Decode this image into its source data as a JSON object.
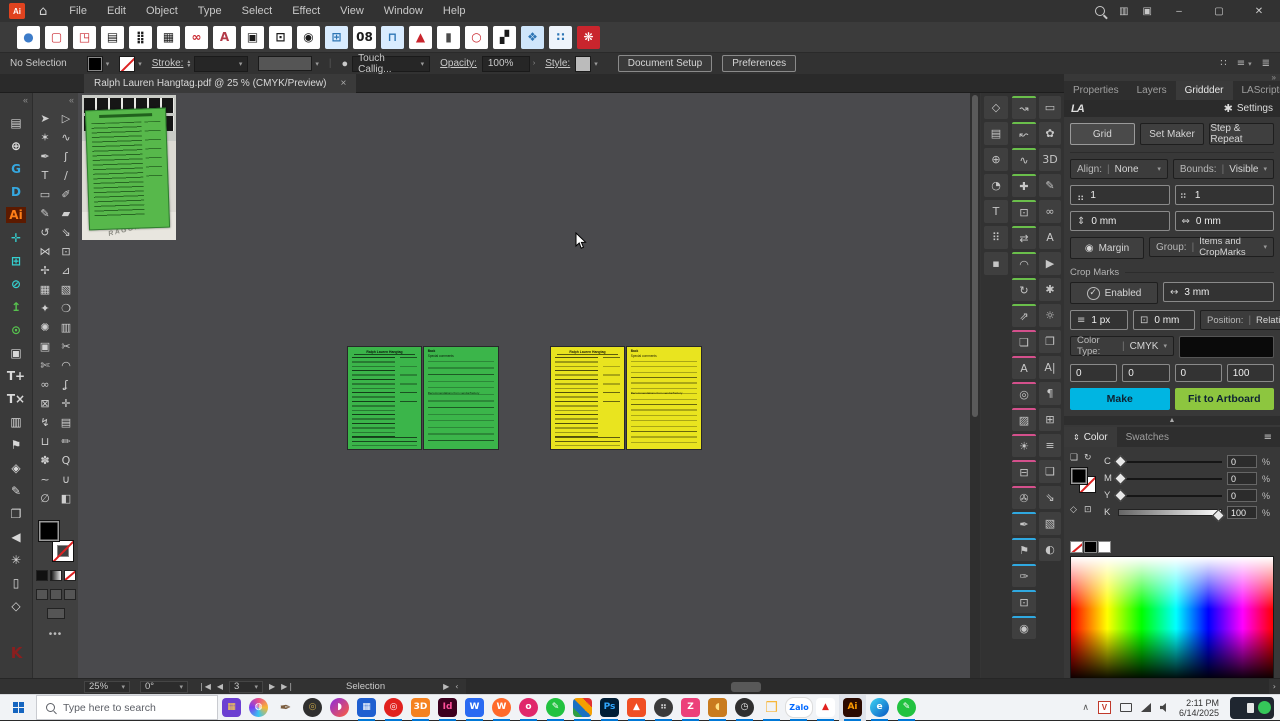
{
  "theme": {
    "bg-dark": "#323232",
    "bg-panel": "#383838",
    "canvas": "#4a4a4d",
    "green": "#3bb54a",
    "yellow": "#e9e41f",
    "make": "#00b5e2",
    "fit": "#8dc63f",
    "accent-run": "#0078d7",
    "taskbar": "#f1f3f6"
  },
  "titlebar": {
    "app_badge": "Ai",
    "menus": [
      "File",
      "Edit",
      "Object",
      "Type",
      "Select",
      "Effect",
      "View",
      "Window",
      "Help"
    ],
    "minimize_glyph": "–",
    "maximize_glyph": "▢",
    "close_glyph": "✕"
  },
  "plugin_toolbar": {
    "icons": [
      {
        "name": "apple-icon",
        "glyph": "●",
        "fg": "#3d7cc9",
        "bg": "#ffffff"
      },
      {
        "name": "red-frame-icon",
        "glyph": "▢",
        "fg": "#c9252d",
        "bg": "#ffffff"
      },
      {
        "name": "red-frame-plus-icon",
        "glyph": "◳",
        "fg": "#c9252d",
        "bg": "#ffffff"
      },
      {
        "name": "storefront-icon",
        "glyph": "▤",
        "fg": "#1b1b1b",
        "bg": "#ffffff"
      },
      {
        "name": "dot-grid-icon",
        "glyph": "⣿",
        "fg": "#1b1b1b",
        "bg": "#ffffff"
      },
      {
        "name": "table-icon",
        "glyph": "▦",
        "fg": "#1b1b1b",
        "bg": "#ffffff"
      },
      {
        "name": "swap-rings-icon",
        "glyph": "∞",
        "fg": "#c9252d",
        "bg": "#ffffff"
      },
      {
        "name": "initial-a-icon",
        "glyph": "A",
        "fg": "#b23a48",
        "bg": "#ffffff"
      },
      {
        "name": "frame-icon",
        "glyph": "▣",
        "fg": "#1b1b1b",
        "bg": "#ffffff"
      },
      {
        "name": "crop-marks-icon",
        "glyph": "⊡",
        "fg": "#1b1b1b",
        "bg": "#ffffff"
      },
      {
        "name": "eye-icon",
        "glyph": "◉",
        "fg": "#1b1b1b",
        "bg": "#ffffff"
      },
      {
        "name": "add-frame-icon",
        "glyph": "⊞",
        "fg": "#2e76b5",
        "bg": "#d9ecff"
      },
      {
        "name": "pages-icon",
        "glyph": "08",
        "fg": "#1b1b1b",
        "bg": "#ffffff"
      },
      {
        "name": "printer-icon",
        "glyph": "⊓",
        "fg": "#2e76b5",
        "bg": "#d9ecff"
      },
      {
        "name": "pdf-icon",
        "glyph": "▲",
        "fg": "#c9252d",
        "bg": "#ffffff"
      },
      {
        "name": "pen-knife-icon",
        "glyph": "▮",
        "fg": "#4a4a4a",
        "bg": "#ffffff"
      },
      {
        "name": "apple-outline-icon",
        "glyph": "○",
        "fg": "#c9252d",
        "bg": "#ffffff"
      },
      {
        "name": "qr-icon",
        "glyph": "▞",
        "fg": "#1b1b1b",
        "bg": "#ffffff"
      },
      {
        "name": "touch-icon",
        "glyph": "❖",
        "fg": "#2e76b5",
        "bg": "#cfe6fb"
      },
      {
        "name": "marquee-dots-icon",
        "glyph": "∷",
        "fg": "#2e76b5",
        "bg": "#eef4fb"
      },
      {
        "name": "flower-icon",
        "glyph": "❋",
        "fg": "#ffffff",
        "bg": "#c9252d"
      }
    ]
  },
  "control_bar": {
    "selection_status": "No Selection",
    "stroke_label": "Stroke:",
    "brush_value": "Touch Callig...",
    "opacity_label": "Opacity:",
    "opacity_value": "100%",
    "style_label": "Style:",
    "document_setup_label": "Document Setup",
    "preferences_label": "Preferences"
  },
  "document_tab": {
    "title": "Ralph Lauren Hangtag.pdf @ 25 % (CMYK/Preview)",
    "close_glyph": "×"
  },
  "left_dock": {
    "icons": [
      {
        "name": "folder-icon",
        "glyph": "▤",
        "fg": "#cfcfcf"
      },
      {
        "name": "add-circle-icon",
        "glyph": "⊕",
        "fg": "#e0e0e0"
      },
      {
        "name": "g-tool-icon",
        "glyph": "G",
        "fg": "#35a8e0"
      },
      {
        "name": "d-tool-icon",
        "glyph": "D",
        "fg": "#35a8e0"
      },
      {
        "name": "ai-badge-icon",
        "glyph": "Ai",
        "fg": "#ff7f18",
        "bg": "#5c1a00"
      },
      {
        "name": "align-cross-icon",
        "glyph": "✛",
        "fg": "#35d0d0"
      },
      {
        "name": "grid-icon",
        "glyph": "⊞",
        "fg": "#35d0d0"
      },
      {
        "name": "slash-circle-icon",
        "glyph": "⊘",
        "fg": "#35d0d0"
      },
      {
        "name": "export-icon",
        "glyph": "↥",
        "fg": "#57c24e"
      },
      {
        "name": "power-icon",
        "glyph": "⊙",
        "fg": "#57c24e"
      },
      {
        "name": "swatch-grid-icon",
        "glyph": "▣",
        "fg": "#d8d8d8"
      },
      {
        "name": "type-plus-icon",
        "glyph": "T+",
        "fg": "#d8d8d8"
      },
      {
        "name": "type-x-icon",
        "glyph": "T×",
        "fg": "#d8d8d8"
      },
      {
        "name": "columns-icon",
        "glyph": "▥",
        "fg": "#d8d8d8"
      },
      {
        "name": "flag-icon",
        "glyph": "⚑",
        "fg": "#d8d8d8"
      },
      {
        "name": "diamond-icon",
        "glyph": "◈",
        "fg": "#d8d8d8"
      },
      {
        "name": "pen-box-icon",
        "glyph": "✎",
        "fg": "#d8d8d8"
      },
      {
        "name": "link-box-icon",
        "glyph": "❐",
        "fg": "#d8d8d8"
      },
      {
        "name": "triangle-icon",
        "glyph": "◀",
        "fg": "#d8d8d8"
      },
      {
        "name": "node-icon",
        "glyph": "✳",
        "fg": "#d8d8d8"
      },
      {
        "name": "book-icon",
        "glyph": "▯",
        "fg": "#d8d8d8"
      },
      {
        "name": "cube-icon",
        "glyph": "◇",
        "fg": "#d8d8d8"
      }
    ],
    "bottom_logo": {
      "name": "k-logo-icon",
      "glyph": "K",
      "fg": "#8b1f1f"
    }
  },
  "toolbar_tools": {
    "items": [
      {
        "name": "selection-tool",
        "glyph": "➤"
      },
      {
        "name": "direct-selection-tool",
        "glyph": "▷"
      },
      {
        "name": "magic-wand-tool",
        "glyph": "✶"
      },
      {
        "name": "lasso-tool",
        "glyph": "∿"
      },
      {
        "name": "pen-tool",
        "glyph": "✒"
      },
      {
        "name": "curvature-tool",
        "glyph": "ʃ"
      },
      {
        "name": "type-tool",
        "glyph": "T"
      },
      {
        "name": "line-tool",
        "glyph": "∕"
      },
      {
        "name": "rectangle-tool",
        "glyph": "▭"
      },
      {
        "name": "paintbrush-tool",
        "glyph": "✐"
      },
      {
        "name": "shaper-tool",
        "glyph": "✎"
      },
      {
        "name": "eraser-tool",
        "glyph": "▰"
      },
      {
        "name": "rotate-tool",
        "glyph": "↺"
      },
      {
        "name": "scale-tool",
        "glyph": "⇘"
      },
      {
        "name": "width-tool",
        "glyph": "⋈"
      },
      {
        "name": "free-transform-tool",
        "glyph": "⊡"
      },
      {
        "name": "puppet-warp-tool",
        "glyph": "✢"
      },
      {
        "name": "perspective-tool",
        "glyph": "⊿"
      },
      {
        "name": "mesh-tool",
        "glyph": "▦"
      },
      {
        "name": "gradient-tool",
        "glyph": "▧"
      },
      {
        "name": "eyedropper-tool",
        "glyph": "✦"
      },
      {
        "name": "blend-tool",
        "glyph": "❍"
      },
      {
        "name": "symbol-sprayer-tool",
        "glyph": "✺"
      },
      {
        "name": "graph-tool",
        "glyph": "▥"
      },
      {
        "name": "artboard-tool",
        "glyph": "▣"
      },
      {
        "name": "slice-tool",
        "glyph": "✂"
      },
      {
        "name": "scissors-tool",
        "glyph": "✄"
      },
      {
        "name": "rotate-view-tool",
        "glyph": "◠"
      },
      {
        "name": "glasses-tool",
        "glyph": "∞"
      },
      {
        "name": "warp-tool",
        "glyph": "ʆ"
      },
      {
        "name": "dice-tool",
        "glyph": "⊠"
      },
      {
        "name": "align-point-tool",
        "glyph": "✛"
      },
      {
        "name": "anchor-tool",
        "glyph": "↯"
      },
      {
        "name": "ruler-tool",
        "glyph": "▤"
      },
      {
        "name": "page-tool",
        "glyph": "⊔"
      },
      {
        "name": "pencil-tool",
        "glyph": "✏"
      },
      {
        "name": "hand-tool",
        "glyph": "✽"
      },
      {
        "name": "zoom-tool",
        "glyph": "Q"
      },
      {
        "name": "smooth-tool",
        "glyph": "~"
      },
      {
        "name": "join-tool",
        "glyph": "∪"
      },
      {
        "name": "measure-tool",
        "glyph": "∅"
      },
      {
        "name": "bucket-tool",
        "glyph": "◧"
      }
    ]
  },
  "canvas": {
    "front_title": "Ralph Lauren Hangtag",
    "back_heading": "Back",
    "back_sub": "Special comments",
    "back_note": "Recommendations from vendor/factory",
    "photo_text": "RAGON"
  },
  "right_strips": {
    "a": [
      {
        "name": "cube-panel-icon",
        "glyph": "◇"
      },
      {
        "name": "sheet-panel-icon",
        "glyph": "▤"
      },
      {
        "name": "target-panel-icon",
        "glyph": "⊕"
      },
      {
        "name": "pie-panel-icon",
        "glyph": "◔"
      },
      {
        "name": "type-panel-icon",
        "glyph": "T"
      },
      {
        "name": "scatter-panel-icon",
        "glyph": "⠿"
      },
      {
        "name": "square-panel-icon",
        "glyph": "▪"
      }
    ],
    "b": [
      {
        "name": "curve-panel-icon",
        "glyph": "↝",
        "accent": "#6abf4b"
      },
      {
        "name": "handles-panel-icon",
        "glyph": "↜",
        "accent": "#6abf4b"
      },
      {
        "name": "wave-panel-icon",
        "glyph": "∿",
        "accent": "#6abf4b"
      },
      {
        "name": "plus-panel-icon",
        "glyph": "✚",
        "accent": "#6abf4b"
      },
      {
        "name": "select-box-panel-icon",
        "glyph": "⊡",
        "accent": "#6abf4b"
      },
      {
        "name": "swap-panel-icon",
        "glyph": "⇄",
        "accent": "#6abf4b"
      },
      {
        "name": "arc-panel-icon",
        "glyph": "◠",
        "accent": "#6abf4b"
      },
      {
        "name": "replace-panel-icon",
        "glyph": "↻",
        "accent": "#6abf4b"
      },
      {
        "name": "arrows-panel-icon",
        "glyph": "⇗",
        "accent": "#6abf4b"
      },
      {
        "name": "shadow-panel-icon",
        "glyph": "❏",
        "accent": "#d4508c"
      },
      {
        "name": "type-style-panel-icon",
        "glyph": "A",
        "accent": "#d4508c"
      },
      {
        "name": "zoom-art-panel-icon",
        "glyph": "◎",
        "accent": "#d4508c"
      },
      {
        "name": "image-panel-icon",
        "glyph": "▨",
        "accent": "#d4508c"
      },
      {
        "name": "brightness-panel-icon",
        "glyph": "☀",
        "accent": "#d4508c"
      },
      {
        "name": "projector-panel-icon",
        "glyph": "⊟",
        "accent": "#d4508c"
      },
      {
        "name": "tape-panel-icon",
        "glyph": "✇",
        "accent": "#d4508c"
      },
      {
        "name": "fountain-pen-panel-icon",
        "glyph": "✒",
        "accent": "#2fa8e0"
      },
      {
        "name": "flag-pen-panel-icon",
        "glyph": "⚑",
        "accent": "#2fa8e0"
      },
      {
        "name": "nib-panel-icon",
        "glyph": "✑",
        "accent": "#2fa8e0"
      },
      {
        "name": "dotted-box-panel-icon",
        "glyph": "⊡",
        "accent": "#2fa8e0"
      },
      {
        "name": "circles-panel-icon",
        "glyph": "◉",
        "accent": "#2fa8e0"
      }
    ],
    "c": [
      {
        "name": "artboard-panel-icon",
        "glyph": "▭"
      },
      {
        "name": "shape-panel-icon",
        "glyph": "✿"
      },
      {
        "name": "threed-panel-icon",
        "glyph": "3D"
      },
      {
        "name": "brushes-panel-icon",
        "glyph": "✎"
      },
      {
        "name": "links-panel-icon",
        "glyph": "∞"
      },
      {
        "name": "baseline-panel-icon",
        "glyph": "A"
      },
      {
        "name": "actions-panel-icon",
        "glyph": "▶"
      },
      {
        "name": "gears-panel-icon",
        "glyph": "✱"
      },
      {
        "name": "sun-panel-icon",
        "glyph": "☼"
      },
      {
        "name": "copy-panel-icon",
        "glyph": "❐"
      },
      {
        "name": "type-cursor-panel-icon",
        "glyph": "A|"
      },
      {
        "name": "paragraph-panel-icon",
        "glyph": "¶"
      },
      {
        "name": "dotted-frame-panel-icon",
        "glyph": "⊞"
      },
      {
        "name": "align-panel-icon",
        "glyph": "≡"
      },
      {
        "name": "pathfinder-panel-icon",
        "glyph": "❑"
      },
      {
        "name": "export-panel-icon",
        "glyph": "⇘"
      },
      {
        "name": "gradient-panel-icon",
        "glyph": "▧"
      },
      {
        "name": "transparency-panel-icon",
        "glyph": "◐"
      }
    ]
  },
  "griddder": {
    "tabs": [
      "Properties",
      "Layers",
      "Griddder",
      "LAScripts"
    ],
    "active_tab": "Griddder",
    "logo": "LA",
    "settings_label": "Settings",
    "mode_grid": "Grid",
    "mode_set_maker": "Set Maker",
    "mode_step_repeat": "Step & Repeat",
    "align_label": "Align:",
    "align_value": "None",
    "bounds_label": "Bounds:",
    "bounds_value": "Visible",
    "rows_value": "1",
    "cols_value": "1",
    "vspace_value": "0 mm",
    "hspace_value": "0 mm",
    "margin_label": "Margin",
    "group_label": "Group:",
    "group_value": "Items and CropMarks",
    "crop_marks_label": "Crop Marks",
    "enabled_label": "Enabled",
    "bleed_value": "3 mm",
    "stroke_value": "1 px",
    "offset_value": "0 mm",
    "position_label": "Position:",
    "position_value": "Relative",
    "color_type_label": "Color Type:",
    "color_type_value": "CMYK",
    "cmyk": [
      "0",
      "0",
      "0",
      "100"
    ],
    "make_label": "Make",
    "fit_label": "Fit to Artboard"
  },
  "color_panel": {
    "tab_color": "Color",
    "tab_swatches": "Swatches",
    "sliders": [
      {
        "label": "C",
        "value": "0"
      },
      {
        "label": "M",
        "value": "0"
      },
      {
        "label": "Y",
        "value": "0"
      },
      {
        "label": "K",
        "value": "100",
        "grad": true
      }
    ],
    "percent": "%"
  },
  "status_bar": {
    "zoom": "25%",
    "rotation": "0°",
    "page": "3",
    "tool": "Selection"
  },
  "taskbar": {
    "search_placeholder": "Type here to search",
    "apps": [
      {
        "name": "filmora-icon",
        "glyph": "▦",
        "fg": "#ffd24a",
        "bg": "#6c3fd1",
        "shape": "rounded"
      },
      {
        "name": "copilot-icon",
        "glyph": "◍",
        "fg": "#ffffff",
        "bg": "conic-gradient(from 0deg,#e94f8a,#f7b733,#36c5f0,#7a3df0,#e94f8a)",
        "shape": "circle"
      },
      {
        "name": "quill-icon",
        "glyph": "✒",
        "fg": "#7a5c3e",
        "shape": "plain"
      },
      {
        "name": "lens-icon",
        "glyph": "◎",
        "fg": "#caa84b",
        "bg": "#2f2f2f",
        "shape": "circle"
      },
      {
        "name": "swoosh-app-icon",
        "glyph": "◗",
        "fg": "#ffffff",
        "bg": "linear-gradient(135deg,#8a2be2,#ff5e3a)",
        "shape": "circle"
      },
      {
        "name": "calculator-icon",
        "glyph": "▦",
        "fg": "#ffffff",
        "bg": "#1f5fd0",
        "shape": "rounded",
        "ul": true
      },
      {
        "name": "opera-icon",
        "glyph": "◎",
        "fg": "#ffffff",
        "bg": "#e1211e",
        "shape": "circle",
        "ul": true
      },
      {
        "name": "threed-app-icon",
        "glyph": "3D",
        "fg": "#ffffff",
        "bg": "#f5821f",
        "shape": "rounded",
        "ul": true
      },
      {
        "name": "indesign-icon",
        "glyph": "Id",
        "fg": "#ff4f9a",
        "bg": "#3d001f",
        "shape": "rounded",
        "ul": true
      },
      {
        "name": "wps-blue-icon",
        "glyph": "W",
        "fg": "#ffffff",
        "bg": "#2a6af2",
        "shape": "rounded",
        "ul": true
      },
      {
        "name": "w-orange-icon",
        "glyph": "W",
        "fg": "#ffffff",
        "bg": "#ff6a2b",
        "shape": "circle",
        "ul": true
      },
      {
        "name": "o-pink-icon",
        "glyph": "o",
        "fg": "#ffffff",
        "bg": "#e0286b",
        "shape": "circle",
        "ul": true
      },
      {
        "name": "green-pen-icon",
        "glyph": "✎",
        "fg": "#ffffff",
        "bg": "#22c240",
        "shape": "circle",
        "ul": true
      },
      {
        "name": "mosaic-icon",
        "glyph": "",
        "fg": "#ffffff",
        "bg": "linear-gradient(45deg,#2f9e44 25%,#1971c2 25% 50%,#f59f00 50% 75%,#e03131 75%)",
        "shape": "rounded",
        "ul": true
      },
      {
        "name": "photoshop-icon",
        "glyph": "Ps",
        "fg": "#31a8ff",
        "bg": "#001e36",
        "shape": "rounded",
        "ul": true
      },
      {
        "name": "triangle-app-icon",
        "glyph": "▲",
        "fg": "#ffffff",
        "bg": "#f04e23",
        "shape": "rounded",
        "ul": true
      },
      {
        "name": "dots-app-icon",
        "glyph": "⠶",
        "fg": "#cccccc",
        "bg": "#3a3a3a",
        "shape": "circle",
        "ul": true
      },
      {
        "name": "zalo-z-icon",
        "glyph": "Z",
        "fg": "#ffffff",
        "bg": "#ec407a",
        "shape": "rounded",
        "ul": true
      },
      {
        "name": "banana-app-icon",
        "glyph": "◖",
        "fg": "#ffe082",
        "bg": "#c97b1e",
        "shape": "rounded",
        "ul": true
      },
      {
        "name": "clock-app-icon",
        "glyph": "◷",
        "fg": "#e8e8e8",
        "bg": "#2f2f2f",
        "shape": "circle",
        "ul": true
      },
      {
        "name": "file-explorer-icon",
        "glyph": "❒",
        "fg": "#f6b73c",
        "shape": "plain",
        "ul": true
      },
      {
        "name": "zalo-pill-icon",
        "glyph": "Zalo",
        "fg": "#0068ff",
        "bg": "#ffffff",
        "shape": "pill",
        "ul": true
      },
      {
        "name": "acrobat-icon",
        "glyph": "▲",
        "fg": "#e1211e",
        "bg": "#ffffff",
        "shape": "rounded",
        "ul": true
      },
      {
        "name": "illustrator-icon",
        "glyph": "Ai",
        "fg": "#ff9a00",
        "bg": "#2b0a00",
        "shape": "rounded",
        "ul": true,
        "active": true
      },
      {
        "name": "edge-icon",
        "glyph": "e",
        "fg": "#ffffff",
        "bg": "linear-gradient(135deg,#3dd5f3,#0a57c2)",
        "shape": "circle",
        "ul": true
      },
      {
        "name": "green-pen2-icon",
        "glyph": "✎",
        "fg": "#ffffff",
        "bg": "#22c240",
        "shape": "circle",
        "ul": true
      }
    ],
    "tray": {
      "time": "2:11 PM",
      "date": "6/14/2025",
      "v_badge": "V"
    }
  }
}
